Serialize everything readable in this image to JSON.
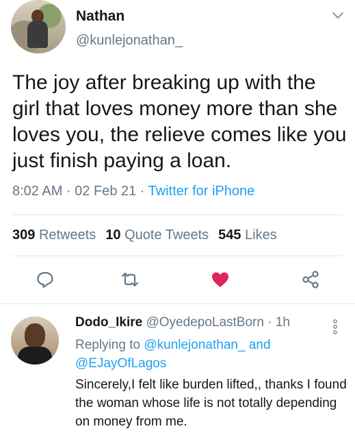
{
  "tweet": {
    "author_name": "Nathan",
    "author_handle": "@kunlejonathan_",
    "text": "The joy after breaking up with the girl that loves money more than she loves you, the relieve comes like you just finish paying a loan.",
    "time": "8:02 AM",
    "sep1": " · ",
    "date": "02 Feb 21",
    "sep2": " · ",
    "source": "Twitter for iPhone",
    "retweets_count": "309",
    "retweets_label": "Retweets",
    "quote_count": "10",
    "quote_label": "Quote Tweets",
    "likes_count": "545",
    "likes_label": "Likes"
  },
  "actions": {
    "reply_icon": "reply-icon",
    "retweet_icon": "retweet-icon",
    "like_icon": "heart-icon",
    "share_icon": "share-icon"
  },
  "reply": {
    "author_name": "Dodo_Ikire",
    "author_handle": "@OyedepoLastBorn",
    "sep": " · ",
    "time": "1h",
    "replying_prefix": "Replying to ",
    "mention1": "@kunlejonathan_",
    "and": " and",
    "mention2": "@EJayOfLagos",
    "text": "Sincerely,I felt like burden lifted,, thanks I found the woman whose life is not totally depending on money from me."
  },
  "colors": {
    "accent": "#1da1f2",
    "like": "#e0245e",
    "secondary_text": "#657786",
    "primary_text": "#14171a"
  }
}
